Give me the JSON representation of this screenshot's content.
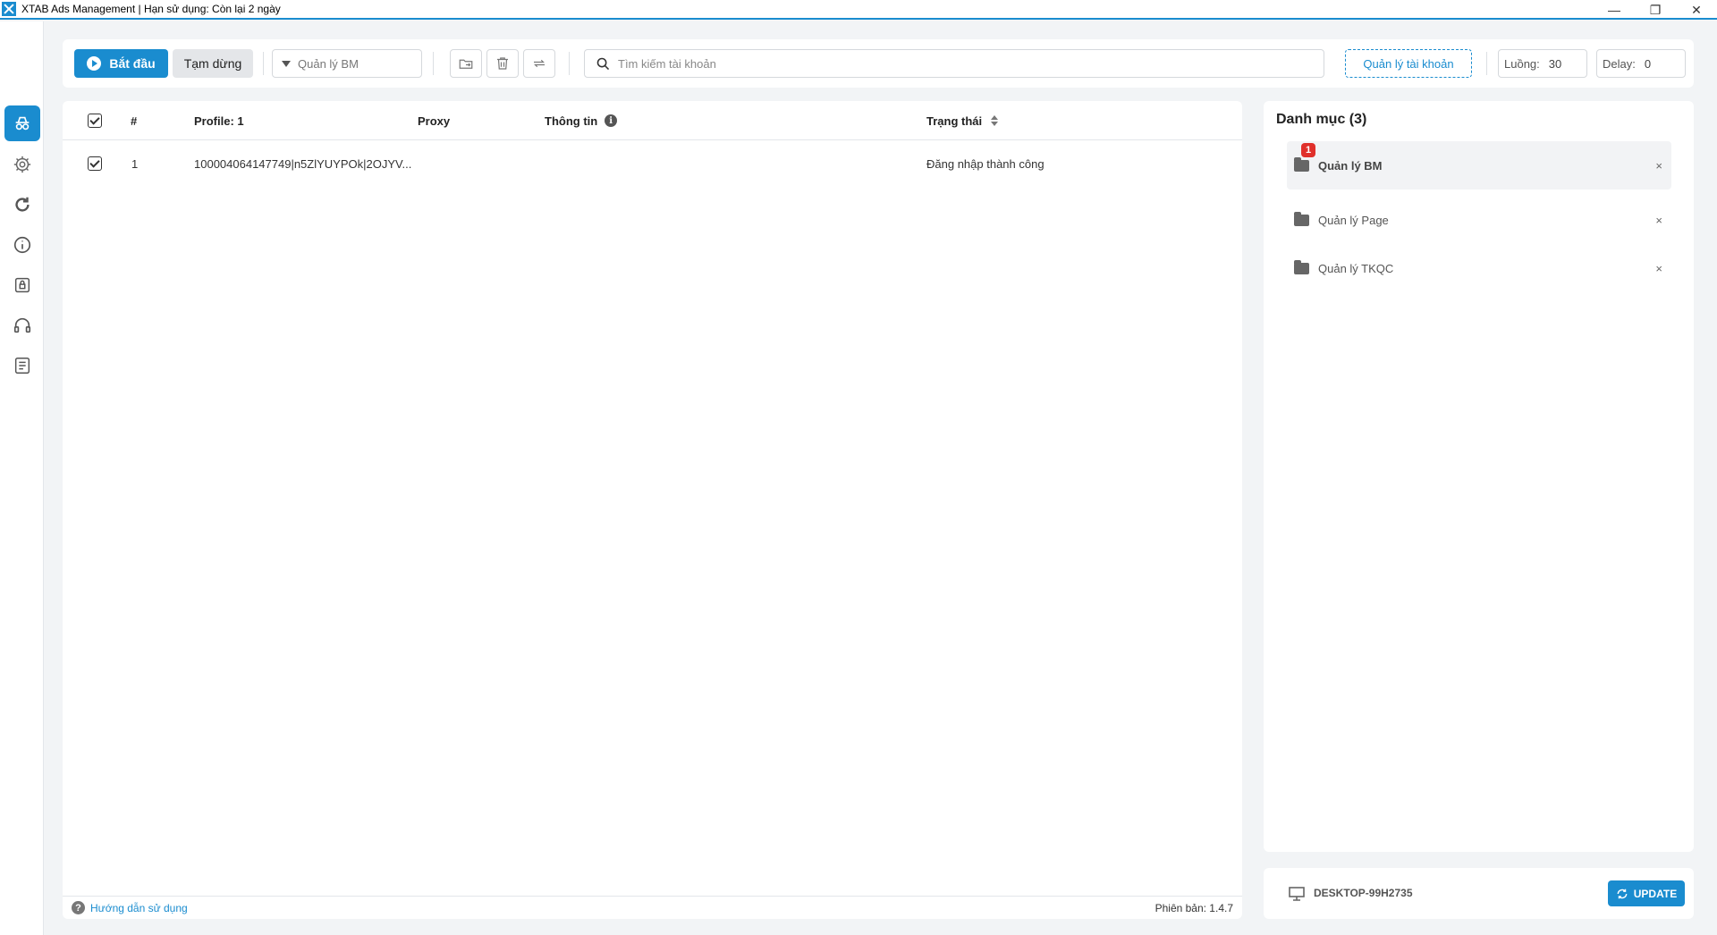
{
  "window": {
    "title": "XTAB Ads Management | Hạn sử dụng: Còn lại 2 ngày",
    "controls": [
      "minimize",
      "restore",
      "close"
    ]
  },
  "sidebar": {
    "items": [
      {
        "icon": "incognito-icon",
        "active": true
      },
      {
        "icon": "gear-icon",
        "active": false
      },
      {
        "icon": "refresh-icon",
        "active": false
      },
      {
        "icon": "info-icon",
        "active": false
      },
      {
        "icon": "lock-icon",
        "active": false
      },
      {
        "icon": "headset-icon",
        "active": false
      },
      {
        "icon": "document-icon",
        "active": false
      }
    ]
  },
  "toolbar": {
    "start_label": "Bắt đầu",
    "pause_label": "Tạm dừng",
    "select_value": "Quản lý BM",
    "search_placeholder": "Tìm kiếm tài khoản",
    "manage_accounts_label": "Quản lý tài khoản",
    "threads_label": "Luồng:",
    "threads_value": "30",
    "delay_label": "Delay:",
    "delay_value": "0"
  },
  "table": {
    "headers": {
      "index": "#",
      "profile": "Profile: 1",
      "proxy": "Proxy",
      "info": "Thông tin",
      "status": "Trạng thái"
    },
    "rows": [
      {
        "checked": true,
        "index": "1",
        "profile": "100004064147749|n5ZlYUYPOk|2OJYV...",
        "proxy": "",
        "info": "",
        "status": "Đăng nhập thành công"
      }
    ],
    "footer_help": "Hướng dẫn sử dụng",
    "footer_version": "Phiên bản: 1.4.7"
  },
  "categories": {
    "title": "Danh mục (3)",
    "items": [
      {
        "label": "Quản lý BM",
        "badge": "1",
        "active": true
      },
      {
        "label": "Quản lý Page",
        "badge": "",
        "active": false
      },
      {
        "label": "Quản lý TKQC",
        "badge": "",
        "active": false
      }
    ],
    "close_glyph": "×"
  },
  "device": {
    "name": "DESKTOP-99H2735",
    "update_label": "UPDATE"
  },
  "colors": {
    "accent": "#1a8ccf",
    "badge": "#e0302b"
  }
}
